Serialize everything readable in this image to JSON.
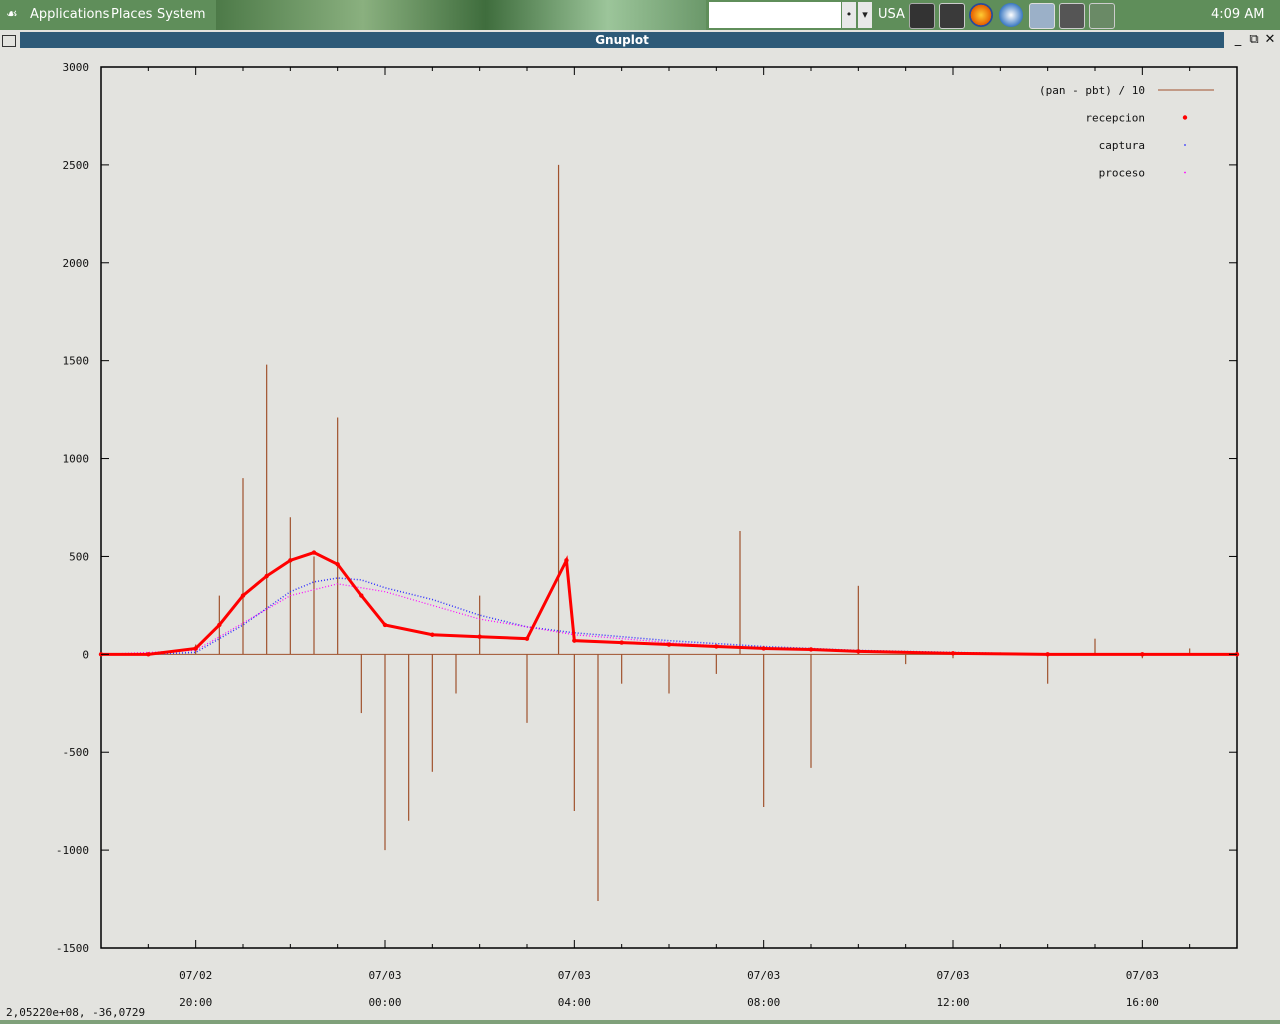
{
  "panel": {
    "menu": [
      "Applications",
      "Places",
      "System"
    ],
    "keyboard_layout": "USA",
    "clock": "4:09 AM",
    "launchers": [
      "terminal-icon",
      "monitor-icon",
      "firefox-icon",
      "thunderbird-icon",
      "settings-icon",
      "calculator-icon",
      "drive-icon"
    ]
  },
  "window": {
    "title": "Gnuplot"
  },
  "status_text": "2,05220e+08, -36,0729",
  "colors": {
    "diff": "#a0522d",
    "recepcion": "#ff0000",
    "captura": "#3030ff",
    "proceso": "#ff00ff"
  },
  "chart_data": {
    "type": "line",
    "title": "",
    "xlabel": "",
    "ylabel": "",
    "ylim": [
      -1500,
      3000
    ],
    "yticks": [
      "3000",
      "2500",
      "2000",
      "1500",
      "1000",
      "500",
      "0",
      "-500",
      "-1000",
      "-1500"
    ],
    "xticks": [
      {
        "date": "07/02",
        "time": "20:00"
      },
      {
        "date": "07/03",
        "time": "00:00"
      },
      {
        "date": "07/03",
        "time": "04:00"
      },
      {
        "date": "07/03",
        "time": "08:00"
      },
      {
        "date": "07/03",
        "time": "12:00"
      },
      {
        "date": "07/03",
        "time": "16:00"
      }
    ],
    "legend_position": "top-right",
    "series": [
      {
        "name": "(pan - pbt) / 10",
        "style": "impulses",
        "x": [
          "07/02 18:00",
          "07/02 19:00",
          "07/02 20:00",
          "07/02 20:30",
          "07/02 21:00",
          "07/02 21:30",
          "07/02 22:00",
          "07/02 22:30",
          "07/02 23:00",
          "07/02 23:30",
          "07/03 00:00",
          "07/03 00:30",
          "07/03 01:00",
          "07/03 01:30",
          "07/03 02:00",
          "07/03 03:00",
          "07/03 03:40",
          "07/03 04:00",
          "07/03 04:30",
          "07/03 05:00",
          "07/03 06:00",
          "07/03 07:00",
          "07/03 07:30",
          "07/03 08:00",
          "07/03 09:00",
          "07/03 10:00",
          "07/03 11:00",
          "07/03 12:00",
          "07/03 13:00",
          "07/03 14:00",
          "07/03 15:00",
          "07/03 16:00",
          "07/03 17:00",
          "07/03 18:00"
        ],
        "y": [
          0,
          0,
          50,
          300,
          900,
          1480,
          700,
          500,
          1210,
          -300,
          -1000,
          -850,
          -600,
          -200,
          300,
          -350,
          2500,
          -800,
          -1260,
          -150,
          -200,
          -100,
          630,
          -780,
          -580,
          350,
          -50,
          -20,
          10,
          -150,
          80,
          -20,
          30,
          0
        ]
      },
      {
        "name": "recepcion",
        "style": "points",
        "x": [
          "07/02 18:00",
          "07/02 19:00",
          "07/02 20:00",
          "07/02 20:30",
          "07/02 21:00",
          "07/02 21:30",
          "07/02 22:00",
          "07/02 22:30",
          "07/02 23:00",
          "07/02 23:30",
          "07/03 00:00",
          "07/03 01:00",
          "07/03 02:00",
          "07/03 03:00",
          "07/03 03:50",
          "07/03 04:00",
          "07/03 05:00",
          "07/03 06:00",
          "07/03 07:00",
          "07/03 08:00",
          "07/03 09:00",
          "07/03 10:00",
          "07/03 12:00",
          "07/03 14:00",
          "07/03 16:00",
          "07/03 18:00"
        ],
        "y": [
          0,
          0,
          30,
          150,
          300,
          400,
          480,
          520,
          460,
          300,
          150,
          100,
          90,
          80,
          480,
          70,
          60,
          50,
          40,
          30,
          25,
          15,
          5,
          0,
          0,
          0
        ]
      },
      {
        "name": "captura",
        "style": "dots",
        "x": [
          "07/02 18:00",
          "07/02 19:00",
          "07/02 20:00",
          "07/02 21:00",
          "07/02 22:00",
          "07/02 22:30",
          "07/02 23:00",
          "07/02 23:30",
          "07/03 00:00",
          "07/03 01:00",
          "07/03 02:00",
          "07/03 03:00",
          "07/03 04:00",
          "07/03 05:00",
          "07/03 06:00",
          "07/03 08:00",
          "07/03 10:00",
          "07/03 12:00",
          "07/03 14:00",
          "07/03 16:00",
          "07/03 18:00"
        ],
        "y": [
          0,
          0,
          10,
          150,
          320,
          370,
          390,
          380,
          340,
          280,
          200,
          140,
          110,
          90,
          70,
          40,
          20,
          10,
          0,
          0,
          0
        ]
      },
      {
        "name": "proceso",
        "style": "dots",
        "x": [
          "07/02 18:00",
          "07/02 20:00",
          "07/02 22:00",
          "07/02 23:00",
          "07/03 00:00",
          "07/03 02:00",
          "07/03 04:00",
          "07/03 06:00",
          "07/03 08:00",
          "07/03 12:00",
          "07/03 18:00"
        ],
        "y": [
          0,
          20,
          300,
          360,
          320,
          180,
          100,
          60,
          30,
          5,
          0
        ]
      }
    ]
  }
}
